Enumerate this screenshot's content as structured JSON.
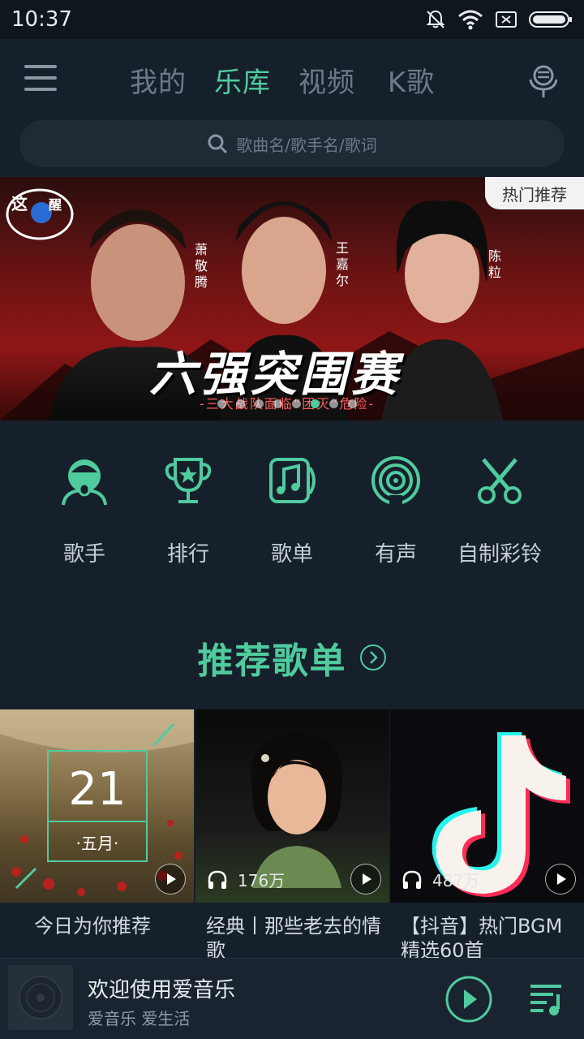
{
  "status": {
    "time": "10:37"
  },
  "nav": {
    "tabs": [
      "我的",
      "乐库",
      "视频",
      "K歌"
    ],
    "active_tab_index": 1
  },
  "search": {
    "placeholder": "歌曲名/歌手名/歌词"
  },
  "banner": {
    "badge": "热门推荐",
    "title": "六强突围赛",
    "subtitle": "-三大战队面临“团灭”危险-",
    "singers": [
      "萧敬腾",
      "王嘉尔",
      "陈粒"
    ],
    "slide_count": 8,
    "active_slide_index": 5
  },
  "quick_entries": [
    {
      "label": "歌手",
      "icon": "singer-icon"
    },
    {
      "label": "排行",
      "icon": "trophy-icon"
    },
    {
      "label": "歌单",
      "icon": "playlist-icon"
    },
    {
      "label": "有声",
      "icon": "broadcast-icon"
    },
    {
      "label": "自制彩铃",
      "icon": "scissors-icon"
    }
  ],
  "section": {
    "title": "推荐歌单"
  },
  "playlists": [
    {
      "title": "今日为你推荐",
      "day": "21",
      "month": "·五月·",
      "plays": ""
    },
    {
      "title": "经典丨那些老去的情歌",
      "plays": "176万"
    },
    {
      "title": "【抖音】热门BGM精选60首",
      "plays": "487万"
    }
  ],
  "player": {
    "title": "欢迎使用爱音乐",
    "subtitle": "爱音乐  爱生活"
  },
  "colors": {
    "accent": "#4fcb9e",
    "background": "#16202b"
  }
}
